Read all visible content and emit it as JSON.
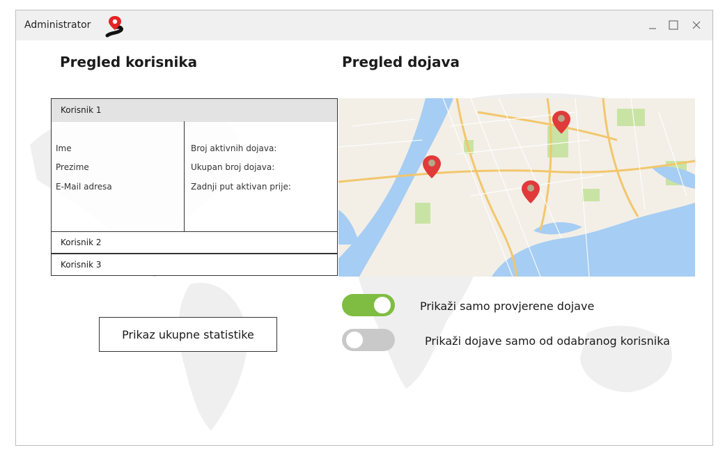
{
  "window": {
    "title": "Administrator"
  },
  "users_section": {
    "heading": "Pregled korisnika"
  },
  "reports_section": {
    "heading": "Pregled dojava"
  },
  "users": [
    {
      "label": "Korisnik 1",
      "expanded": true,
      "details_left": [
        "Ime",
        "Prezime",
        "E-Mail adresa"
      ],
      "details_right": [
        "Broj aktivnih dojava:",
        "Ukupan broj dojava:",
        "Zadnji put aktivan prije:"
      ]
    },
    {
      "label": "Korisnik 2",
      "expanded": false
    },
    {
      "label": "Korisnik 3",
      "expanded": false
    }
  ],
  "stats_button": {
    "label": "Prikaz ukupne statistike"
  },
  "toggles": [
    {
      "label": "Prikaži samo provjerene dojave",
      "on": true
    },
    {
      "label": "Prikaži dojave samo od odabranog korisnika",
      "on": false
    }
  ],
  "colors": {
    "toggle_on": "#7fbd42",
    "toggle_off": "#c9c9c9",
    "pin": "#e03a3a",
    "water": "#a6cdf3"
  },
  "map": {
    "pins": [
      "map-pin-icon",
      "map-pin-icon",
      "map-pin-icon"
    ]
  }
}
